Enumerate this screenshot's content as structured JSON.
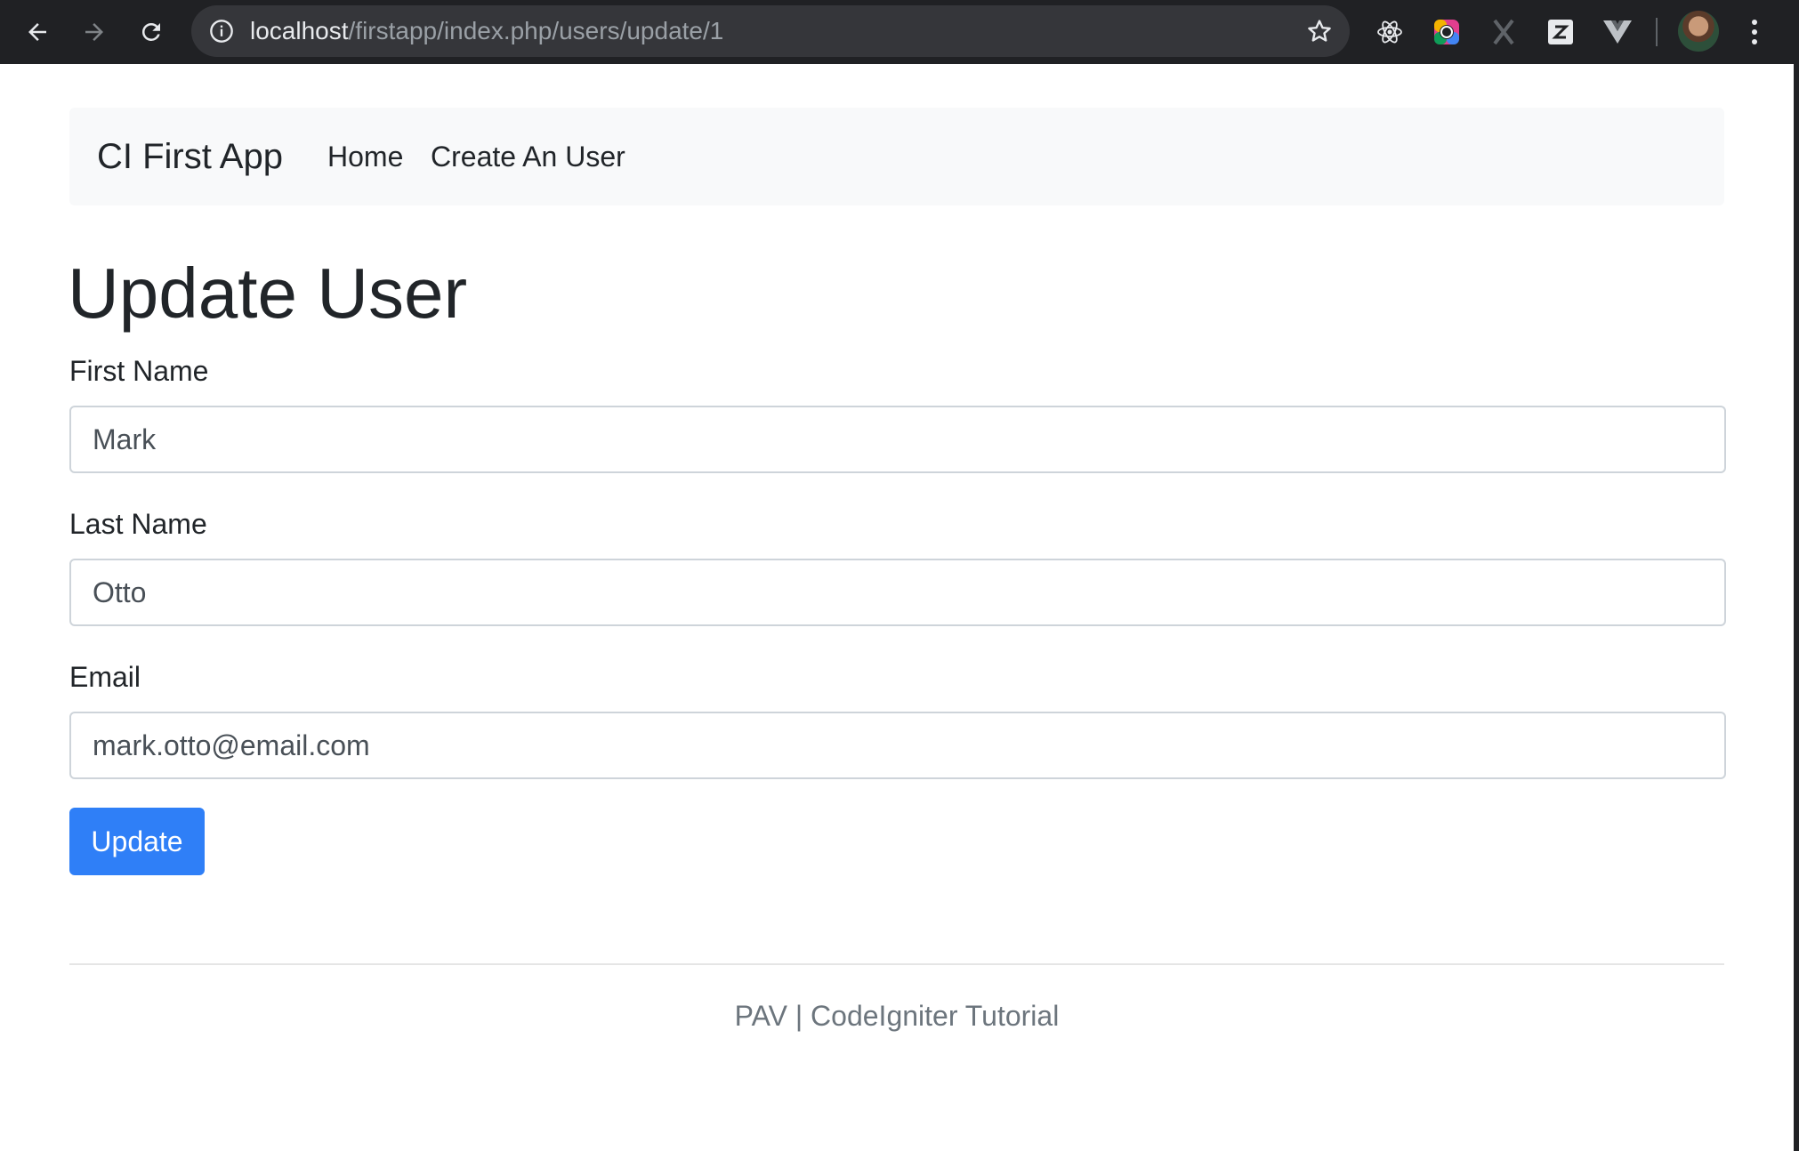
{
  "browser": {
    "url_host": "localhost",
    "url_path": "/firstapp/index.php/users/update/1"
  },
  "navbar": {
    "brand": "CI First App",
    "links": [
      "Home",
      "Create An User"
    ]
  },
  "page": {
    "title": "Update User"
  },
  "form": {
    "first_name": {
      "label": "First Name",
      "value": "Mark"
    },
    "last_name": {
      "label": "Last Name",
      "value": "Otto"
    },
    "email": {
      "label": "Email",
      "value": "mark.otto@email.com"
    },
    "submit_label": "Update"
  },
  "footer": {
    "text": "PAV | CodeIgniter Tutorial"
  },
  "icons": {
    "back": "arrow-left-icon",
    "forward": "arrow-right-icon",
    "reload": "reload-icon",
    "info": "info-icon",
    "bookmark": "star-icon",
    "extensions": [
      "react-devtools-icon",
      "color-picker-icon",
      "x-extension-icon",
      "z-extension-icon",
      "vue-devtools-icon"
    ],
    "menu": "more-vert-icon"
  },
  "colors": {
    "chrome_bg": "#202124",
    "omnibox_bg": "#35363a",
    "navbar_bg": "#f8f9fa",
    "primary": "#2f7ff7",
    "text": "#212529",
    "muted": "#6c757d"
  }
}
